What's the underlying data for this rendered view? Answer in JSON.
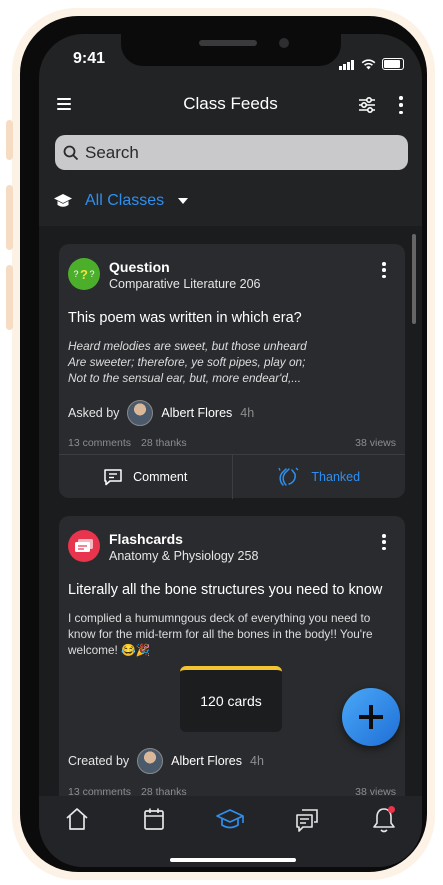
{
  "status_bar": {
    "time": "9:41"
  },
  "app_bar": {
    "title": "Class Feeds"
  },
  "search": {
    "placeholder": "Search"
  },
  "class_filter": {
    "selected": "All Classes"
  },
  "feed": [
    {
      "type": "Question",
      "course": "Comparative Literature 206",
      "title": "This poem was written in which era?",
      "body_lines": [
        "Heard melodies are sweet, but those unheard",
        "Are sweeter; therefore, ye soft pipes, play on;",
        "Not to the sensual ear, but, more endear'd,..."
      ],
      "byline_prefix": "Asked by",
      "author": "Albert Flores",
      "ago": "4h",
      "comments": "13 comments",
      "thanks": "28 thanks",
      "views": "38 views",
      "comment_label": "Comment",
      "thanked_label": "Thanked",
      "icon_color": "#4caf2c"
    },
    {
      "type": "Flashcards",
      "course": "Anatomy & Physiology 258",
      "title": "Literally all the bone structures you need to know",
      "body_lines": [
        "I complied a humumngous deck of everything you need to",
        "know for the mid-term for all the bones in the body!! You're",
        "welcome! 😂🎉"
      ],
      "deck_label": "120 cards",
      "byline_prefix": "Created by",
      "author": "Albert Flores",
      "ago": "4h",
      "comments": "13 comments",
      "thanks": "28 thanks",
      "views": "38 views",
      "icon_color": "#e8344d"
    }
  ],
  "tabs": [
    {
      "name": "home-icon"
    },
    {
      "name": "calendar-icon"
    },
    {
      "name": "classes-icon",
      "active": true
    },
    {
      "name": "messages-icon"
    },
    {
      "name": "notifications-icon",
      "badge": true
    }
  ],
  "colors": {
    "accent": "#2f8ff0",
    "background": "#222325",
    "card": "#2a2b2e"
  }
}
